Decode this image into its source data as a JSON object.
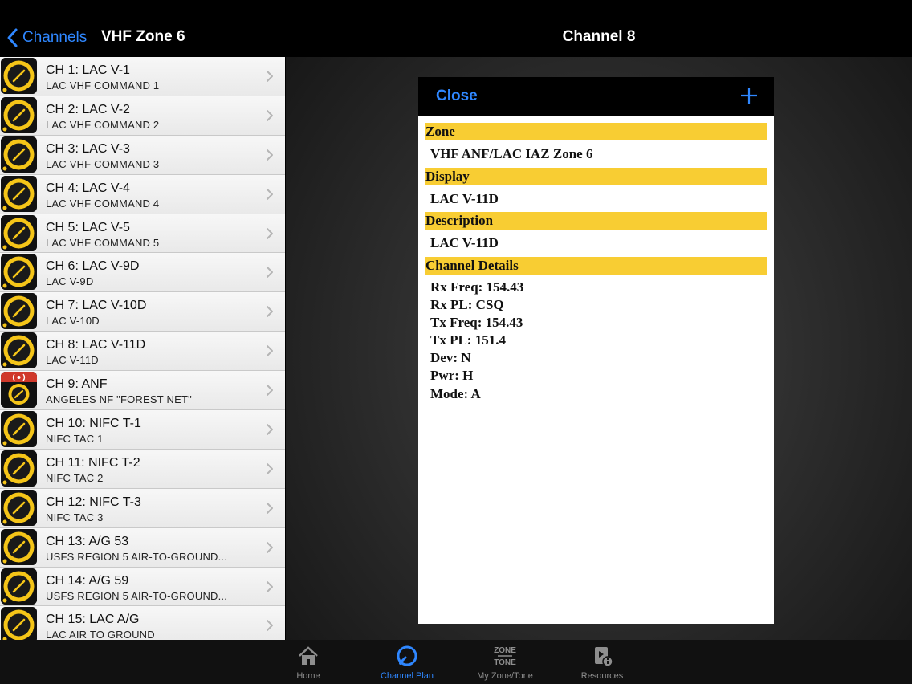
{
  "left_nav": {
    "back_label": "Channels",
    "title": "VHF Zone 6"
  },
  "channels": [
    {
      "title": "CH 1: LAC V-1",
      "subtitle": "LAC VHF COMMAND 1",
      "icon": "knob-icon"
    },
    {
      "title": "CH 2: LAC V-2",
      "subtitle": "LAC VHF COMMAND 2",
      "icon": "knob-icon"
    },
    {
      "title": "CH 3: LAC V-3",
      "subtitle": "LAC VHF COMMAND 3",
      "icon": "knob-icon"
    },
    {
      "title": "CH 4: LAC V-4",
      "subtitle": "LAC VHF COMMAND 4",
      "icon": "knob-icon"
    },
    {
      "title": "CH 5: LAC V-5",
      "subtitle": "LAC VHF COMMAND 5",
      "icon": "knob-icon"
    },
    {
      "title": "CH 6: LAC V-9D",
      "subtitle": "LAC V-9D",
      "icon": "knob-icon"
    },
    {
      "title": "CH 7: LAC V-10D",
      "subtitle": "LAC V-10D",
      "icon": "knob-icon"
    },
    {
      "title": "CH 8: LAC V-11D",
      "subtitle": "LAC V-11D",
      "icon": "knob-icon"
    },
    {
      "title": "CH 9: ANF",
      "subtitle": "ANGELES NF \"FOREST NET\"",
      "icon": "knob-with-antenna-icon"
    },
    {
      "title": "CH 10: NIFC T-1",
      "subtitle": "NIFC TAC 1",
      "icon": "knob-icon"
    },
    {
      "title": "CH 11: NIFC T-2",
      "subtitle": "NIFC TAC 2",
      "icon": "knob-icon"
    },
    {
      "title": "CH 12: NIFC T-3",
      "subtitle": "NIFC TAC 3",
      "icon": "knob-icon"
    },
    {
      "title": "CH 13: A/G 53",
      "subtitle": "USFS REGION 5 AIR-TO-GROUND...",
      "icon": "knob-icon"
    },
    {
      "title": "CH 14: A/G 59",
      "subtitle": "USFS REGION 5 AIR-TO-GROUND...",
      "icon": "knob-icon"
    },
    {
      "title": "CH 15: LAC A/G",
      "subtitle": "LAC AIR TO GROUND",
      "icon": "knob-icon"
    }
  ],
  "detail": {
    "nav_title": "Channel 8",
    "close_label": "Close",
    "add_icon": "plus-icon",
    "zone_header": "Zone",
    "zone_value": "VHF ANF/LAC IAZ Zone 6",
    "display_header": "Display",
    "display_value": "LAC V-11D",
    "description_header": "Description",
    "description_value": "LAC V-11D",
    "details_header": "Channel Details",
    "details_lines": [
      "Rx Freq: 154.43",
      "Rx PL: CSQ",
      "Tx Freq: 154.43",
      "Tx PL: 151.4",
      "Dev: N",
      "Pwr: H",
      "Mode: A"
    ]
  },
  "tabs": [
    {
      "label": "Home",
      "icon": "home-icon",
      "active": false
    },
    {
      "label": "Channel Plan",
      "icon": "channel-plan-icon",
      "active": true
    },
    {
      "label": "My Zone/Tone",
      "icon": "zone-tone-icon",
      "active": false
    },
    {
      "label": "Resources",
      "icon": "resources-icon",
      "active": false
    }
  ],
  "colors": {
    "accent": "#2f87ff",
    "section_header": "#f8cd33",
    "knob_yellow": "#f5c518",
    "antenna_red": "#d0392b"
  }
}
